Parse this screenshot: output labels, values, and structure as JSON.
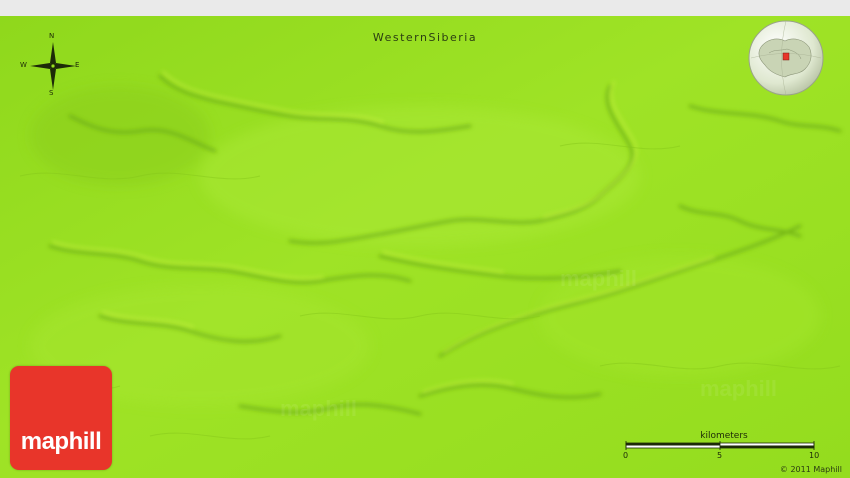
{
  "map": {
    "region_label": "WesternSiberia",
    "terrain_color": "#98e020",
    "shadow_color": "#6fb014",
    "highlight_color": "#c4f040"
  },
  "compass": {
    "north": "N",
    "south": "S",
    "east": "E",
    "west": "W"
  },
  "locator": {
    "icon": "globe-locator-icon",
    "marker_color": "#e8352a"
  },
  "logo": {
    "text": "maphill",
    "color": "#e8352a"
  },
  "scale": {
    "unit": "kilometers",
    "ticks": [
      "0",
      "5",
      "10"
    ]
  },
  "copyright": "© 2011 Maphill"
}
